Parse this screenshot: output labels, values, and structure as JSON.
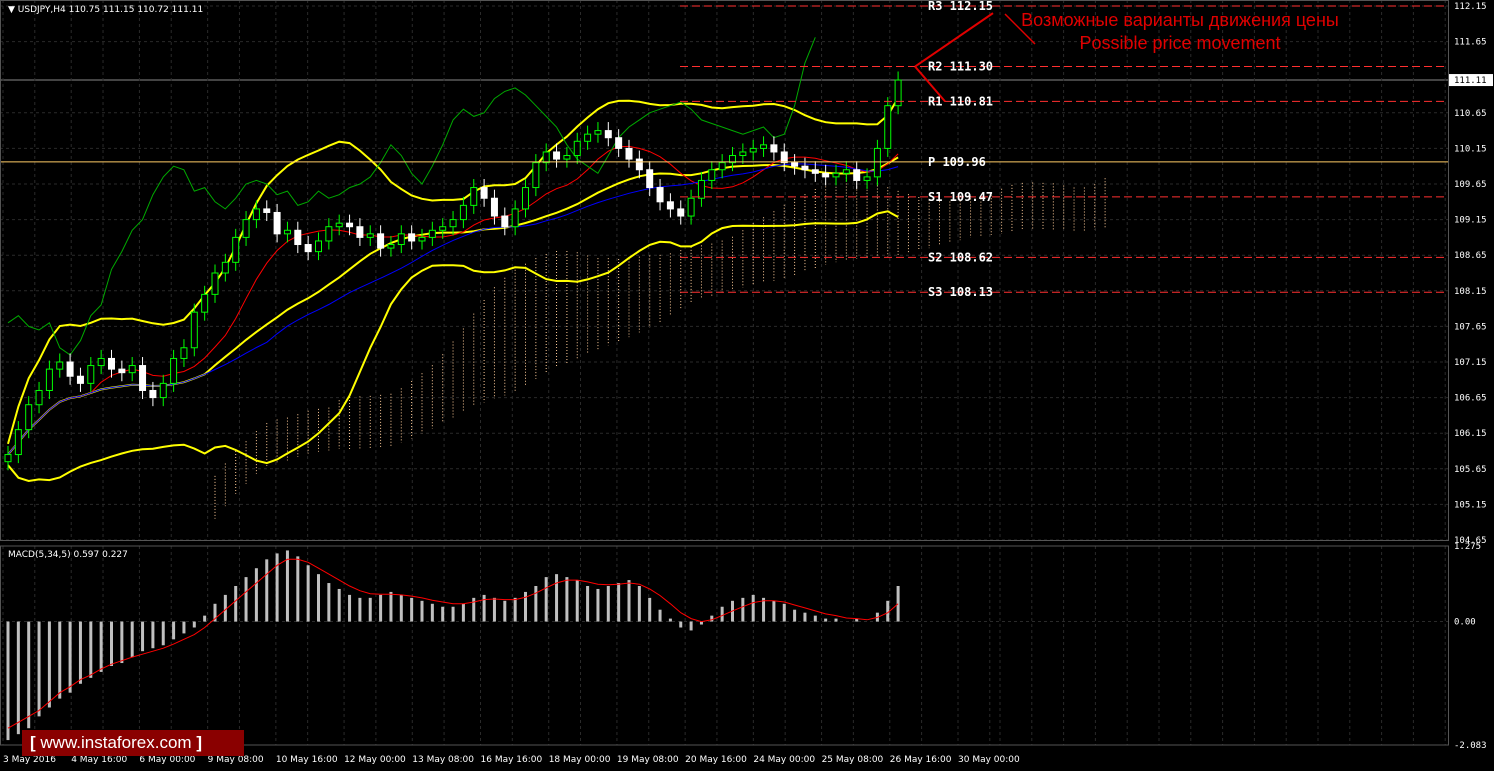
{
  "header": {
    "symbol_line": "USDJPY,H4  110.75 111.15 110.72 111.11",
    "macd_line": "MACD(5,34,5) 0.597 0.227"
  },
  "logo": {
    "text": "www.instaforex.com"
  },
  "annotation": {
    "ru": "Возможные варианты движения цены",
    "en": "Possible price movement"
  },
  "colors": {
    "background": "#000000",
    "grid": "#2a2a2a",
    "bollinger": "#ffff00",
    "tenkan": "#ff0000",
    "kijun": "#0000ff",
    "chikou": "#00aa00",
    "candle_up": "#00ff00",
    "candle_down": "#ffffff",
    "pivot_lines": "#ff3030",
    "macd_signal": "#ff0000",
    "macd_hist": "#c0c0c0",
    "annotation": "#e00000",
    "logo_bg": "#8a0000"
  },
  "chart_data": {
    "type": "candlestick",
    "symbol": "USDJPY",
    "timeframe": "H4",
    "ylim": [
      104.65,
      112.15
    ],
    "y_ticks": [
      "112.15",
      "111.65",
      "111.11",
      "110.65",
      "110.15",
      "109.65",
      "109.15",
      "108.65",
      "108.15",
      "107.65",
      "107.15",
      "106.65",
      "106.15",
      "105.65",
      "105.15",
      "104.65"
    ],
    "current_price": "111.11",
    "x_ticks": [
      "3 May 2016",
      "4 May 16:00",
      "6 May 00:00",
      "9 May 08:00",
      "10 May 16:00",
      "12 May 00:00",
      "13 May 08:00",
      "16 May 16:00",
      "18 May 00:00",
      "19 May 08:00",
      "20 May 16:00",
      "24 May 00:00",
      "25 May 08:00",
      "26 May 16:00",
      "30 May 00:00"
    ],
    "pivot_levels": [
      {
        "label": "R3 112.15",
        "value": 112.15
      },
      {
        "label": "R2 111.30",
        "value": 111.3
      },
      {
        "label": "R1 110.81",
        "value": 110.81
      },
      {
        "label": "P  109.96",
        "value": 109.96
      },
      {
        "label": "S1 109.47",
        "value": 109.47
      },
      {
        "label": "S2 108.62",
        "value": 108.62
      },
      {
        "label": "S3 108.13",
        "value": 108.13
      }
    ],
    "close_series": [
      105.85,
      106.2,
      106.55,
      106.75,
      107.05,
      107.15,
      106.95,
      106.85,
      107.1,
      107.2,
      107.05,
      107.0,
      107.1,
      106.75,
      106.65,
      106.85,
      107.2,
      107.35,
      107.85,
      108.1,
      108.4,
      108.55,
      108.9,
      109.15,
      109.3,
      109.25,
      108.95,
      109.0,
      108.8,
      108.7,
      108.85,
      109.05,
      109.1,
      109.05,
      108.9,
      108.95,
      108.75,
      108.8,
      108.95,
      108.85,
      108.9,
      109.0,
      109.05,
      109.15,
      109.35,
      109.6,
      109.45,
      109.2,
      109.05,
      109.3,
      109.6,
      109.95,
      110.1,
      110.0,
      110.05,
      110.25,
      110.35,
      110.4,
      110.3,
      110.15,
      110.0,
      109.85,
      109.6,
      109.4,
      109.3,
      109.2,
      109.45,
      109.7,
      109.85,
      109.95,
      110.05,
      110.1,
      110.15,
      110.2,
      110.1,
      109.95,
      109.9,
      109.85,
      109.8,
      109.75,
      109.8,
      109.85,
      109.7,
      109.75,
      110.15,
      110.75,
      111.11
    ],
    "macd": {
      "ylim": [
        -2.083,
        1.275
      ],
      "y_ticks": [
        "1.275",
        "0.00",
        "-2.083"
      ],
      "histogram": [
        -2.0,
        -1.9,
        -1.8,
        -1.6,
        -1.45,
        -1.3,
        -1.2,
        -1.05,
        -0.95,
        -0.85,
        -0.75,
        -0.7,
        -0.6,
        -0.5,
        -0.45,
        -0.4,
        -0.3,
        -0.2,
        -0.1,
        0.1,
        0.3,
        0.45,
        0.6,
        0.75,
        0.9,
        1.05,
        1.15,
        1.2,
        1.1,
        0.95,
        0.8,
        0.65,
        0.55,
        0.45,
        0.4,
        0.4,
        0.45,
        0.5,
        0.45,
        0.4,
        0.35,
        0.3,
        0.25,
        0.25,
        0.3,
        0.4,
        0.45,
        0.4,
        0.35,
        0.4,
        0.5,
        0.6,
        0.75,
        0.8,
        0.75,
        0.7,
        0.6,
        0.55,
        0.6,
        0.65,
        0.7,
        0.6,
        0.4,
        0.2,
        0.05,
        -0.1,
        -0.15,
        -0.05,
        0.1,
        0.25,
        0.35,
        0.4,
        0.45,
        0.4,
        0.35,
        0.3,
        0.2,
        0.15,
        0.1,
        0.05,
        0.05,
        0.0,
        0.05,
        0.0,
        0.15,
        0.35,
        0.6
      ],
      "signal": [
        -1.8,
        -1.7,
        -1.6,
        -1.5,
        -1.35,
        -1.2,
        -1.1,
        -0.98,
        -0.9,
        -0.8,
        -0.72,
        -0.66,
        -0.6,
        -0.55,
        -0.5,
        -0.45,
        -0.38,
        -0.3,
        -0.22,
        -0.1,
        0.05,
        0.2,
        0.35,
        0.5,
        0.65,
        0.8,
        0.95,
        1.05,
        1.05,
        1.0,
        0.9,
        0.8,
        0.7,
        0.6,
        0.52,
        0.47,
        0.46,
        0.46,
        0.45,
        0.43,
        0.4,
        0.36,
        0.33,
        0.3,
        0.3,
        0.33,
        0.37,
        0.38,
        0.37,
        0.37,
        0.41,
        0.48,
        0.57,
        0.65,
        0.7,
        0.7,
        0.67,
        0.63,
        0.62,
        0.63,
        0.65,
        0.63,
        0.55,
        0.44,
        0.3,
        0.15,
        0.05,
        0.0,
        0.03,
        0.1,
        0.18,
        0.25,
        0.32,
        0.35,
        0.35,
        0.33,
        0.28,
        0.23,
        0.18,
        0.13,
        0.1,
        0.06,
        0.05,
        0.03,
        0.07,
        0.15,
        0.3
      ]
    }
  }
}
